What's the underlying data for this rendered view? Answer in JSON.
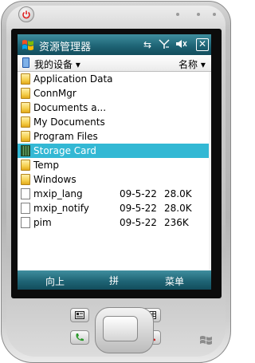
{
  "titlebar": {
    "title": "资源管理器",
    "icons": [
      "connectivity-icon",
      "signal-icon",
      "volume-icon",
      "close-icon"
    ],
    "close_label": "✕"
  },
  "pathbar": {
    "location": "我的设备 ▾",
    "sort": "名称 ▾"
  },
  "files": [
    {
      "name": "Application Data",
      "type": "folder",
      "date": "",
      "size": ""
    },
    {
      "name": "ConnMgr",
      "type": "folder",
      "date": "",
      "size": ""
    },
    {
      "name": "Documents a...",
      "type": "folder",
      "date": "",
      "size": ""
    },
    {
      "name": "My Documents",
      "type": "folder",
      "date": "",
      "size": ""
    },
    {
      "name": "Program Files",
      "type": "folder",
      "date": "",
      "size": ""
    },
    {
      "name": "Storage Card",
      "type": "storage-card",
      "date": "",
      "size": "",
      "selected": true
    },
    {
      "name": "Temp",
      "type": "folder",
      "date": "",
      "size": ""
    },
    {
      "name": "Windows",
      "type": "folder",
      "date": "",
      "size": ""
    },
    {
      "name": "mxip_lang",
      "type": "file",
      "date": "09-5-22",
      "size": "28.0K"
    },
    {
      "name": "mxip_notify",
      "type": "file",
      "date": "09-5-22",
      "size": "28.0K"
    },
    {
      "name": "pim",
      "type": "file",
      "date": "09-5-22",
      "size": "236K"
    }
  ],
  "softkeys": {
    "left": "向上",
    "input": "拼",
    "right": "菜单"
  },
  "colors": {
    "titlebar": "#1f6576",
    "selection": "#33b8d4",
    "folder": "#f5cf4c"
  }
}
